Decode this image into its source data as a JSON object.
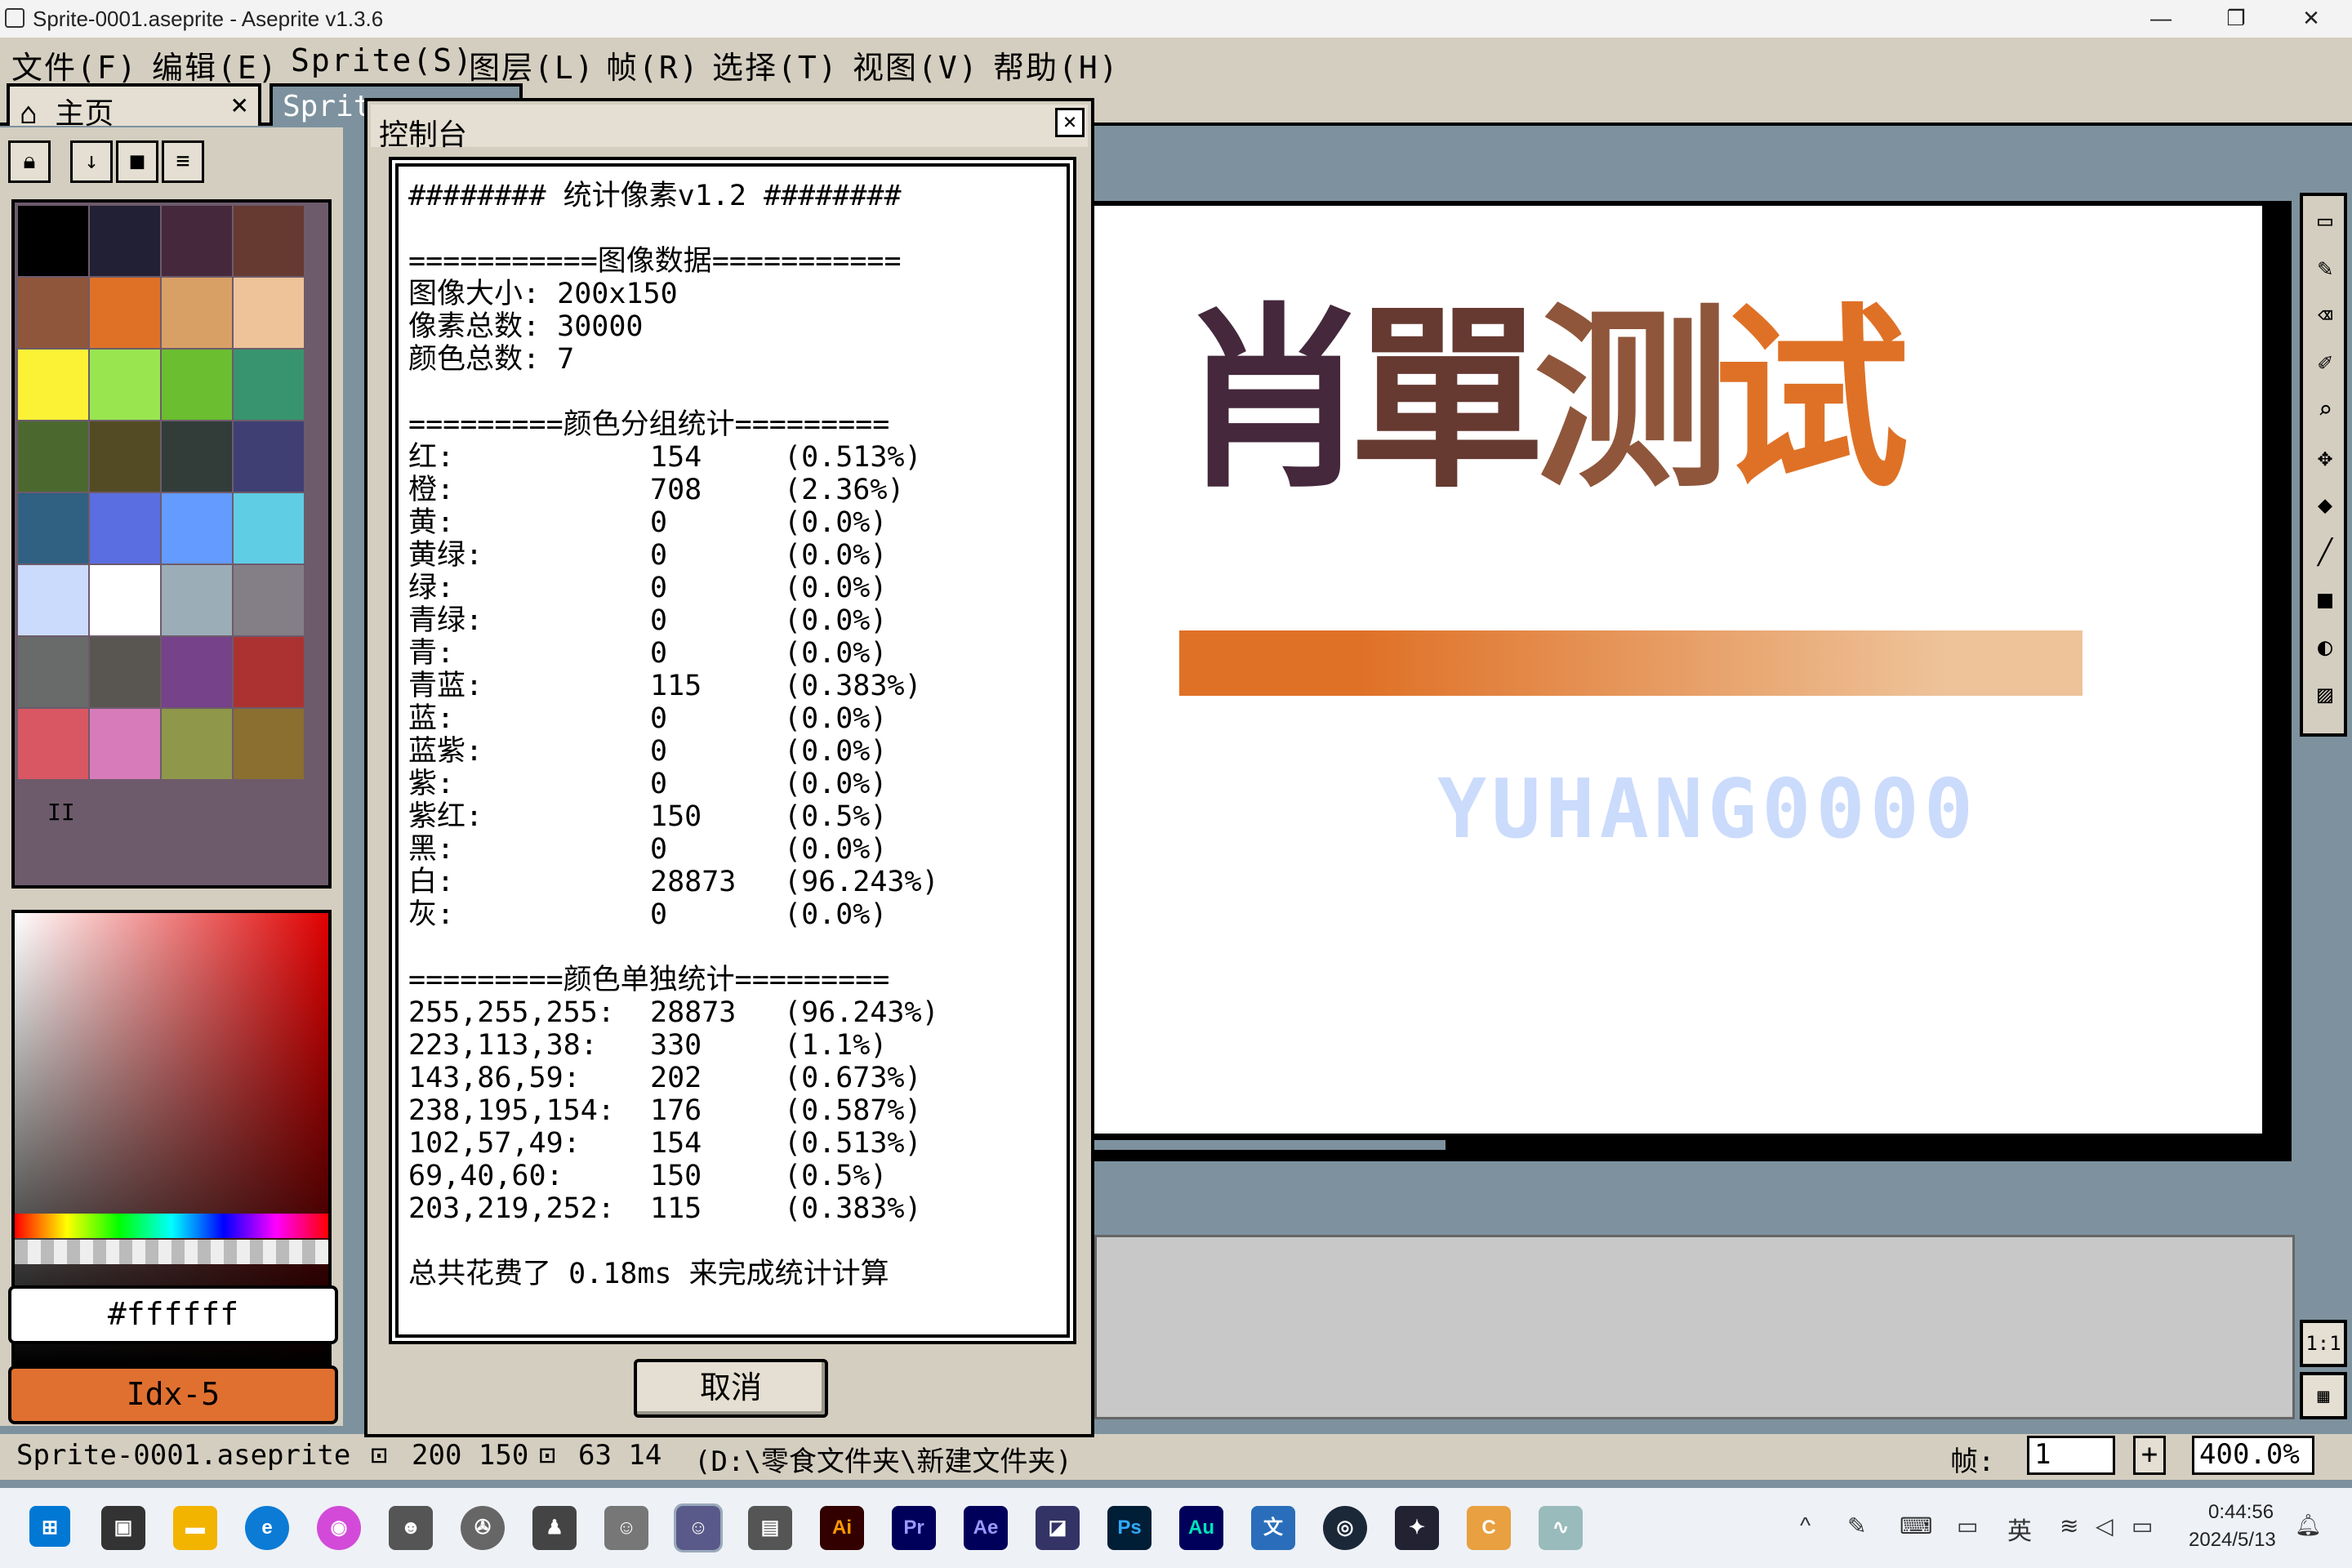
{
  "window": {
    "title": "Sprite-0001.aseprite - Aseprite v1.3.6"
  },
  "menubar": [
    "文件(F)",
    "编辑(E)",
    "Sprite(S)",
    "图层(L)",
    "帧(R)",
    "选择(T)",
    "视图(V)",
    "帮助(H)"
  ],
  "tabs": [
    {
      "label": "主页",
      "close": "×"
    },
    {
      "label": "Sprit"
    }
  ],
  "palette": {
    "colors": [
      "#000000",
      "#222034",
      "#45283c",
      "#663931",
      "#8f563b",
      "#df7126",
      "#d9a066",
      "#eec39a",
      "#fbf236",
      "#99e550",
      "#6abe30",
      "#37946e",
      "#4b692f",
      "#524b24",
      "#323c39",
      "#3f3f74",
      "#306082",
      "#5b6ee1",
      "#639bff",
      "#5fcde4",
      "#cbdbfc",
      "#ffffff",
      "#9badb7",
      "#847e87",
      "#696a6a",
      "#595652",
      "#76428a",
      "#ac3232",
      "#d95763",
      "#d77bba",
      "#8f974a",
      "#8a6f30"
    ],
    "pause_label": "II"
  },
  "color_fields": {
    "hex": "#ffffff",
    "index": "Idx-5"
  },
  "console": {
    "title": "控制台",
    "close": "×",
    "header": "######## 统计像素v1.2 ########",
    "image_section": "===========图像数据===========",
    "image_lines": [
      "图像大小: 200x150",
      "像素总数: 30000",
      "颜色总数: 7"
    ],
    "group_section": "=========颜色分组统计=========",
    "group_rows": [
      {
        "name": "红:",
        "count": "154",
        "pct": "(0.513%)"
      },
      {
        "name": "橙:",
        "count": "708",
        "pct": "(2.36%)"
      },
      {
        "name": "黄:",
        "count": "0",
        "pct": "(0.0%)"
      },
      {
        "name": "黄绿:",
        "count": "0",
        "pct": "(0.0%)"
      },
      {
        "name": "绿:",
        "count": "0",
        "pct": "(0.0%)"
      },
      {
        "name": "青绿:",
        "count": "0",
        "pct": "(0.0%)"
      },
      {
        "name": "青:",
        "count": "0",
        "pct": "(0.0%)"
      },
      {
        "name": "青蓝:",
        "count": "115",
        "pct": "(0.383%)"
      },
      {
        "name": "蓝:",
        "count": "0",
        "pct": "(0.0%)"
      },
      {
        "name": "蓝紫:",
        "count": "0",
        "pct": "(0.0%)"
      },
      {
        "name": "紫:",
        "count": "0",
        "pct": "(0.0%)"
      },
      {
        "name": "紫红:",
        "count": "150",
        "pct": "(0.5%)"
      },
      {
        "name": "黑:",
        "count": "0",
        "pct": "(0.0%)"
      },
      {
        "name": "白:",
        "count": "28873",
        "pct": "(96.243%)"
      },
      {
        "name": "灰:",
        "count": "0",
        "pct": "(0.0%)"
      }
    ],
    "single_section": "=========颜色单独统计=========",
    "single_rows": [
      {
        "name": "255,255,255:",
        "count": "28873",
        "pct": "(96.243%)"
      },
      {
        "name": "223,113,38:",
        "count": "330",
        "pct": "(1.1%)"
      },
      {
        "name": "143,86,59:",
        "count": "202",
        "pct": "(0.673%)"
      },
      {
        "name": "238,195,154:",
        "count": "176",
        "pct": "(0.587%)"
      },
      {
        "name": "102,57,49:",
        "count": "154",
        "pct": "(0.513%)"
      },
      {
        "name": "69,40,60:",
        "count": "150",
        "pct": "(0.5%)"
      },
      {
        "name": "203,219,252:",
        "count": "115",
        "pct": "(0.383%)"
      }
    ],
    "footer": "总共花费了 0.18ms 来完成统计计算",
    "cancel": "取消"
  },
  "canvas": {
    "text_chars": [
      "肖",
      "單",
      "测",
      "试"
    ],
    "char_colors": [
      "#45283c",
      "#663931",
      "#8f563b",
      "#df7126"
    ],
    "signature": "YUHANG0000",
    "signature_color": "#cbdbfc",
    "bar_colors": [
      "#df7126",
      "#eec39a"
    ]
  },
  "toolbar": {
    "tools": [
      "▭",
      "✎",
      "⌫",
      "✐",
      "⌕",
      "✥",
      "◆",
      "╱",
      "■",
      "◐",
      "▨"
    ],
    "ratio": "1:1",
    "film": "▦"
  },
  "statusbar": {
    "file": "Sprite-0001.aseprite",
    "size": "200 150",
    "pos": "63 14",
    "path": "(D:\\零食文件夹\\新建文件夹)",
    "frame_label": "帧:",
    "frame_value": "1",
    "zoom": "400.0%"
  },
  "taskbar": {
    "time": "0:44:56",
    "date": "2024/5/13",
    "lang": "英",
    "apps": [
      {
        "label": "Ai",
        "color": "#330000",
        "fg": "#ff9a00"
      },
      {
        "label": "Pr",
        "color": "#00005b",
        "fg": "#9999ff"
      },
      {
        "label": "Ae",
        "color": "#00005b",
        "fg": "#9999ff"
      },
      {
        "label": "Ps",
        "color": "#001e36",
        "fg": "#31a8ff"
      },
      {
        "label": "Au",
        "color": "#00005b",
        "fg": "#00e4bb"
      }
    ]
  }
}
